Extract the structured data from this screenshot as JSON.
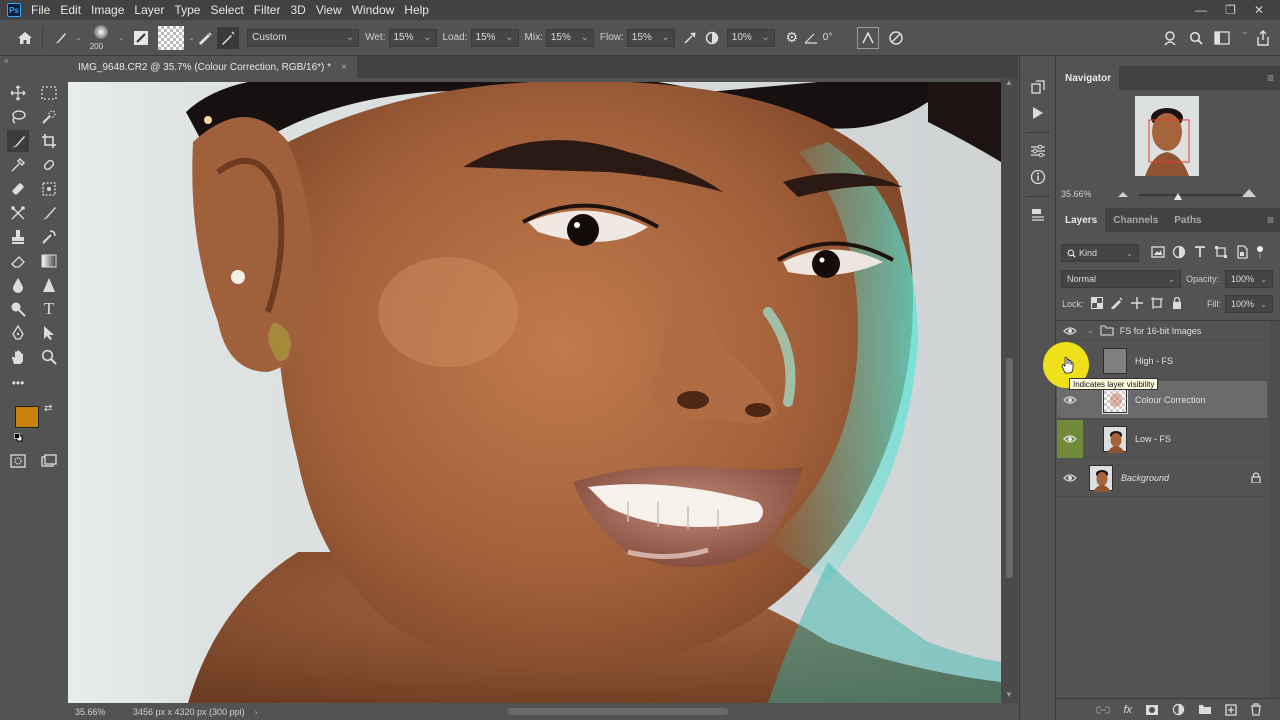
{
  "menubar": {
    "app_badge": "Ps",
    "items": [
      "File",
      "Edit",
      "Image",
      "Layer",
      "Type",
      "Select",
      "Filter",
      "3D",
      "View",
      "Window",
      "Help"
    ],
    "window_controls": [
      "—",
      "❐",
      "✕"
    ]
  },
  "options": {
    "brush_size": "200",
    "mode": "Custom",
    "wet_label": "Wet:",
    "wet": "15%",
    "load_label": "Load:",
    "load": "15%",
    "mix_label": "Mix:",
    "mix": "15%",
    "flow_label": "Flow:",
    "flow": "15%",
    "smoothing": "10%",
    "angle": "0°"
  },
  "document": {
    "tab_title": "IMG_9648.CR2 @ 35.7% (Colour Correction, RGB/16*) *",
    "close": "×"
  },
  "status": {
    "zoom": "35.66%",
    "dimensions": "3456 px x 4320 px (300 ppi)",
    "arrow": "›"
  },
  "colors": {
    "foreground": "#c8820a",
    "background": "#ffffff",
    "selected_layer_eye": "#6f8a3a"
  },
  "navigator": {
    "tab": "Navigator",
    "zoom": "35.66%"
  },
  "layers_panel": {
    "tabs": [
      "Layers",
      "Channels",
      "Paths"
    ],
    "filter_kind": "Kind",
    "blend_mode": "Normal",
    "opacity_label": "Opacity:",
    "opacity": "100%",
    "lock_label": "Lock:",
    "fill_label": "Fill:",
    "fill": "100%",
    "layers": [
      {
        "name": "FS for 16-bit Images",
        "type": "group"
      },
      {
        "name": "High - FS",
        "type": "layer"
      },
      {
        "name": "Colour Correction",
        "type": "layer"
      },
      {
        "name": "Low - FS",
        "type": "layer"
      },
      {
        "name": "Background",
        "type": "background"
      }
    ],
    "tooltip": "Indicates layer visibility"
  }
}
